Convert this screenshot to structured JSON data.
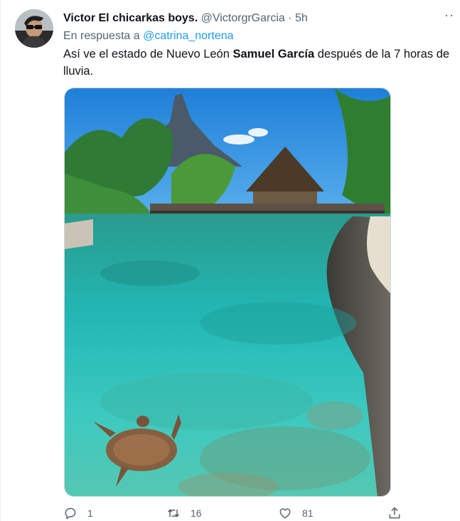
{
  "tweet": {
    "display_name": "Victor El chicarkas boys.",
    "handle": "@VictorgrGarcia",
    "separator": "·",
    "time": "5h",
    "more_label": "··",
    "reply_prefix": "En respuesta a",
    "reply_mention": "@catrina_nortena",
    "text_part1": "Así ve el estado de Nuevo León ",
    "text_bold": "Samuel García",
    "text_part2": " después de la 7 horas de lluvia."
  },
  "actions": {
    "reply_icon": "reply-icon",
    "reply_count": "1",
    "retweet_icon": "retweet-icon",
    "retweet_count": "16",
    "like_icon": "heart-icon",
    "like_count": "81",
    "share_icon": "share-icon"
  },
  "colors": {
    "accent": "#1d9bf0",
    "secondary_text": "#536471",
    "primary_text": "#0f1419"
  }
}
